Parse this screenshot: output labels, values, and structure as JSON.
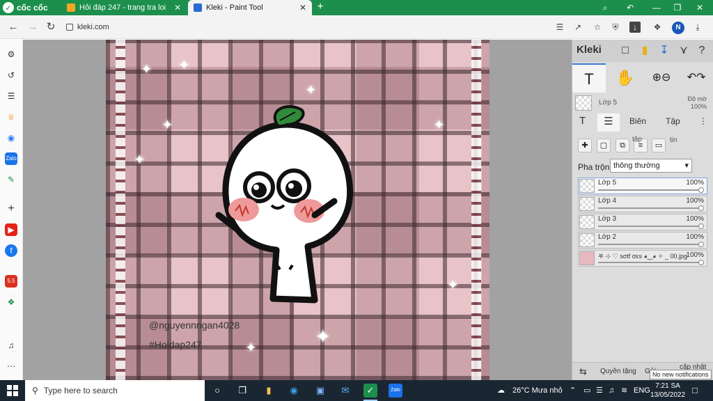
{
  "browser": {
    "brand": "cốc cốc",
    "tabs": [
      {
        "title": "Hỏi đáp 247 - trang tra loi",
        "fav_color": "#f5a623"
      },
      {
        "title": "Kleki - Paint Tool",
        "fav_color": "#2b6cd1"
      }
    ],
    "url": "kleki.com",
    "profile_initial": "N"
  },
  "canvas": {
    "watermark_1": "@nguyennngan4028",
    "watermark_2": "#Hoidap247"
  },
  "kleki": {
    "title": "Kleki",
    "active_layer": "Lớp 5",
    "opacity_label": "Độ mờ",
    "opacity_value": "100%",
    "tab_t": "T",
    "tab_edit": "Biên",
    "tab_file": "Tập",
    "small_tap": "tập",
    "small_tin": "tin",
    "blend_label": "Pha trộn",
    "blend_value": "thông thường",
    "layers": [
      {
        "name": "Lớp 5",
        "pct": "100%"
      },
      {
        "name": "Lớp 4",
        "pct": "100%"
      },
      {
        "name": "Lớp 3",
        "pct": "100%"
      },
      {
        "name": "Lớp 2",
        "pct": "100%"
      },
      {
        "name": "𖤐 ⊹ ♡ sσtf σεs ◕‿◕ ✧ _ 00.jpg",
        "pct": "100%"
      }
    ],
    "footer_rotate": "Quyên tặng",
    "footer_gallery": "Gửi",
    "footer_update": "cập nhật"
  },
  "taskbar": {
    "search_placeholder": "Type here to search",
    "weather": "26°C  Mưa nhỏ",
    "lang": "ENG",
    "time": "7:21 SA",
    "date": "13/05/2022",
    "notification": "No new notifications"
  }
}
